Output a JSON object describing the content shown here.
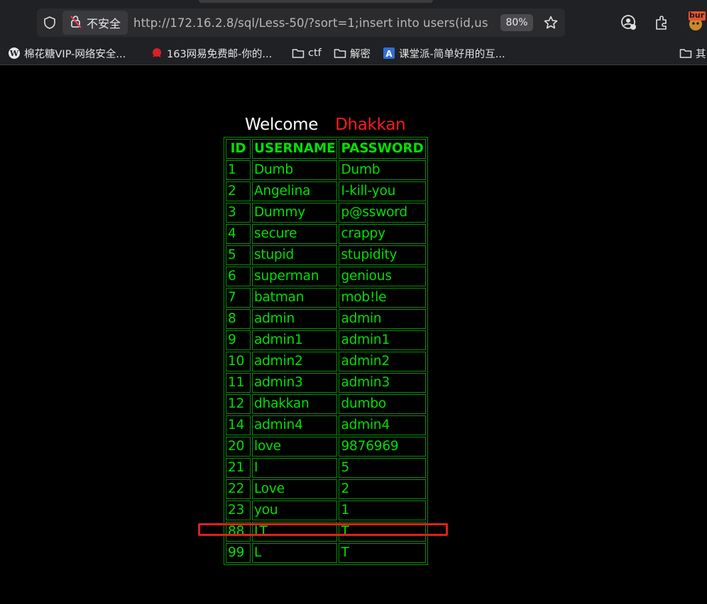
{
  "browser": {
    "security_label": "不安全",
    "url": "http://172.16.2.8/sql/Less-50/?sort=1;insert into users(id,username",
    "zoom": "80%",
    "burp_badge": "bur",
    "bookmarks": [
      {
        "label": "棉花糖VIP-网络安全...",
        "icon": "wordpress-icon"
      },
      {
        "label": "163网易免费邮-你的...",
        "icon": "netease-icon"
      },
      {
        "label": "ctf",
        "icon": "folder-icon"
      },
      {
        "label": "解密",
        "icon": "folder-icon"
      },
      {
        "label": "课堂派-简单好用的互...",
        "icon": "ketangpai-icon"
      },
      {
        "label": "其",
        "icon": "folder-icon"
      }
    ]
  },
  "page": {
    "welcome": "Welcome",
    "username": "Dhakkan",
    "table": {
      "headers": [
        "ID",
        "USERNAME",
        "PASSWORD"
      ],
      "rows": [
        [
          "1",
          "Dumb",
          "Dumb"
        ],
        [
          "2",
          "Angelina",
          "I-kill-you"
        ],
        [
          "3",
          "Dummy",
          "p@ssword"
        ],
        [
          "4",
          "secure",
          "crappy"
        ],
        [
          "5",
          "stupid",
          "stupidity"
        ],
        [
          "6",
          "superman",
          "genious"
        ],
        [
          "7",
          "batman",
          "mob!le"
        ],
        [
          "8",
          "admin",
          "admin"
        ],
        [
          "9",
          "admin1",
          "admin1"
        ],
        [
          "10",
          "admin2",
          "admin2"
        ],
        [
          "11",
          "admin3",
          "admin3"
        ],
        [
          "12",
          "dhakkan",
          "dumbo"
        ],
        [
          "14",
          "admin4",
          "admin4"
        ],
        [
          "20",
          "love",
          "9876969"
        ],
        [
          "21",
          "I",
          "5"
        ],
        [
          "22",
          "Love",
          "2"
        ],
        [
          "23",
          "you",
          "1"
        ],
        [
          "88",
          "LT",
          "T"
        ],
        [
          "99",
          "L",
          "T"
        ]
      ]
    }
  },
  "colors": {
    "table_text": "#00e000",
    "table_border": "#0a8c0a",
    "username": "#ff1a1a",
    "highlight": "#e0201a"
  }
}
